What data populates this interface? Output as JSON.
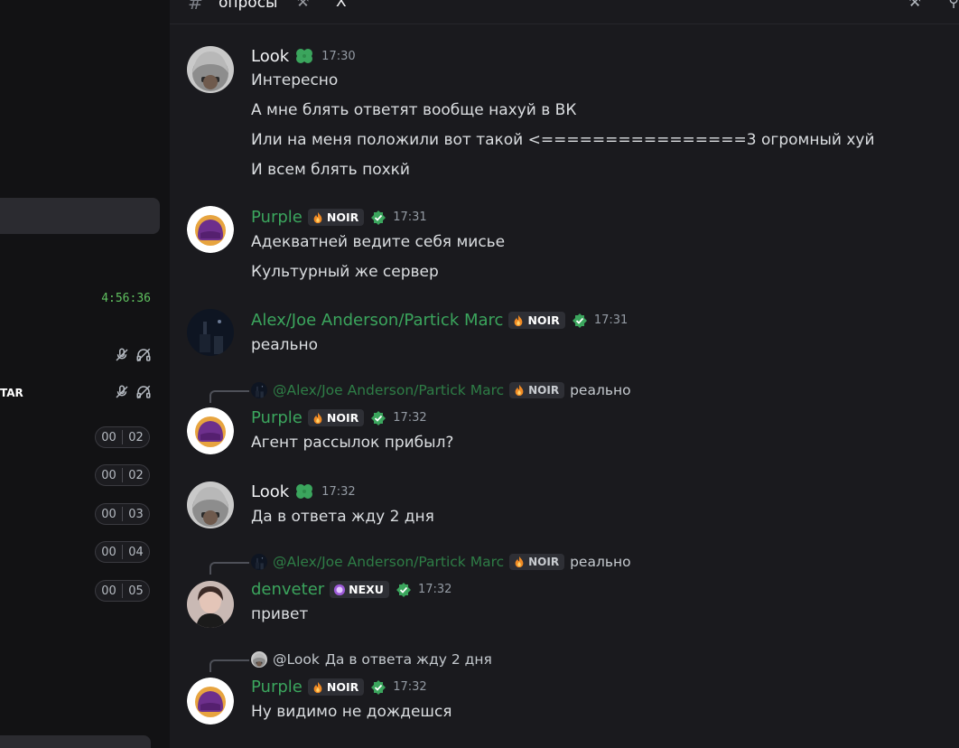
{
  "header": {
    "channel": "опросы",
    "x_label": "Х"
  },
  "sidebar": {
    "timer": "4:56:36",
    "tag_label": "TAR",
    "pills": [
      {
        "left": "00",
        "right": "02"
      },
      {
        "left": "00",
        "right": "02"
      },
      {
        "left": "00",
        "right": "03"
      },
      {
        "left": "00",
        "right": "04"
      },
      {
        "left": "00",
        "right": "05"
      }
    ]
  },
  "colors": {
    "accent_green": "#3ba55d",
    "verified": "#3ba55d",
    "bg": "#1a1a1e"
  },
  "messages": [
    {
      "author": "Look",
      "time": "17:30",
      "lines": [
        "Интересно",
        "А мне блять ответят вообще нахуй в ВК",
        "Или на меня положили вот такой <================3 огромный хуй",
        "И всем блять похкй"
      ]
    },
    {
      "author": "Purple",
      "tag": "NOIR",
      "time": "17:31",
      "lines": [
        "Адекватней ведите себя мисье",
        "Культурный же сервер"
      ]
    },
    {
      "author": "Alex/Joe Anderson/Partick Marc",
      "tag": "NOIR",
      "time": "17:31",
      "lines": [
        "реально"
      ]
    },
    {
      "reply_to": "@Alex/Joe Anderson/Partick Marc",
      "reply_tag": "NOIR",
      "reply_text": "реально",
      "author": "Purple",
      "tag": "NOIR",
      "time": "17:32",
      "lines": [
        "Агент рассылок прибыл?"
      ]
    },
    {
      "author": "Look",
      "time": "17:32",
      "lines": [
        "Да в ответа жду 2 дня"
      ]
    },
    {
      "reply_to": "@Alex/Joe Anderson/Partick Marc",
      "reply_tag": "NOIR",
      "reply_text": "реально",
      "author": "denveter",
      "tag": "NEXU",
      "time": "17:32",
      "lines": [
        "привет"
      ]
    },
    {
      "reply_to": "@Look",
      "reply_text": "Да в ответа жду 2 дня",
      "author": "Purple",
      "tag": "NOIR",
      "time": "17:32",
      "lines": [
        "Ну видимо не дождешся"
      ]
    }
  ]
}
